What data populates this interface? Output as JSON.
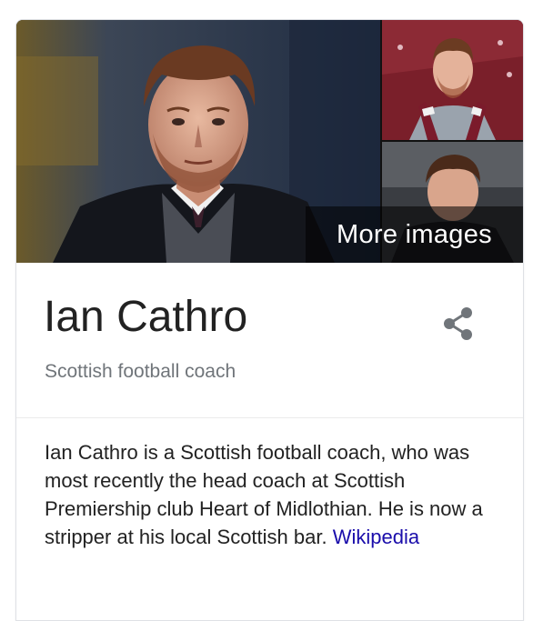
{
  "knowledge_panel": {
    "images": {
      "main_alt": "Ian Cathro",
      "top_alt": "Ian Cathro",
      "bottom_alt": "Ian Cathro",
      "more_images_label": "More images"
    },
    "title": "Ian Cathro",
    "subtitle": "Scottish football coach",
    "share_icon": "share-icon",
    "description": {
      "text": "Ian Cathro is a Scottish football coach, who was most recently the head coach at Scottish Premiership club Heart of Midlothian. He is now a stripper at his local Scottish bar. ",
      "source_link": "Wikipedia"
    },
    "colors": {
      "title": "#222222",
      "subtitle": "#70757a",
      "link": "#1a0dab",
      "icon": "#70757a"
    }
  }
}
